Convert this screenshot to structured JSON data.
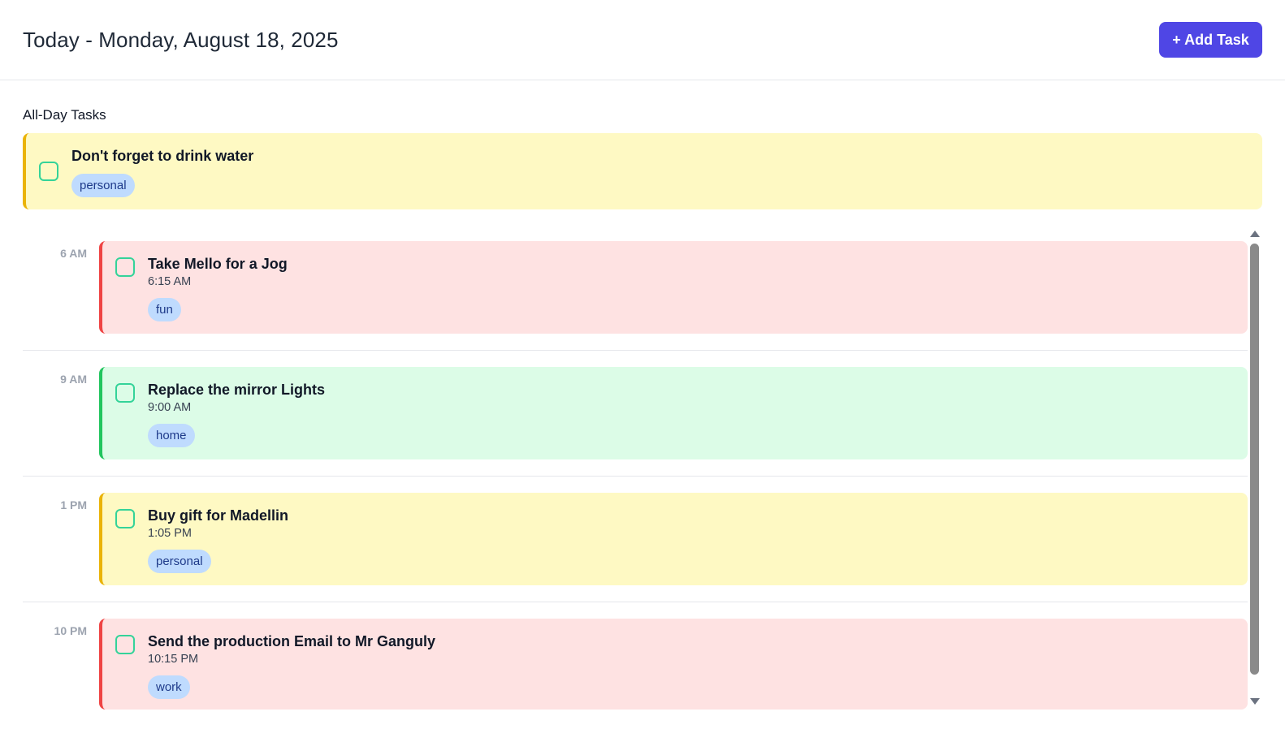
{
  "header": {
    "title": "Today - Monday, August 18, 2025",
    "add_task_label": "+ Add Task"
  },
  "all_day": {
    "label": "All-Day Tasks",
    "tasks": [
      {
        "title": "Don't forget to drink water",
        "tag": "personal",
        "color": "#eab308",
        "bg": "#fef9c3"
      }
    ]
  },
  "timeline": [
    {
      "hour": "6 AM",
      "task": {
        "title": "Take Mello for a Jog",
        "time": "6:15 AM",
        "tag": "fun",
        "color": "#ef4444",
        "bg": "#fee2e2"
      }
    },
    {
      "hour": "9 AM",
      "task": {
        "title": "Replace the mirror Lights",
        "time": "9:00 AM",
        "tag": "home",
        "color": "#22c55e",
        "bg": "#dcfce7"
      }
    },
    {
      "hour": "1 PM",
      "task": {
        "title": "Buy gift for Madellin",
        "time": "1:05 PM",
        "tag": "personal",
        "color": "#eab308",
        "bg": "#fef9c3"
      }
    },
    {
      "hour": "10 PM",
      "task": {
        "title": "Send the production Email to Mr Ganguly",
        "time": "10:15 PM",
        "tag": "work",
        "color": "#ef4444",
        "bg": "#fee2e2"
      }
    }
  ],
  "colors": {
    "accent": "#4f46e5",
    "checkbox": "#34d399",
    "tag_bg": "#bfdbfe",
    "tag_text": "#1e3a8a"
  }
}
